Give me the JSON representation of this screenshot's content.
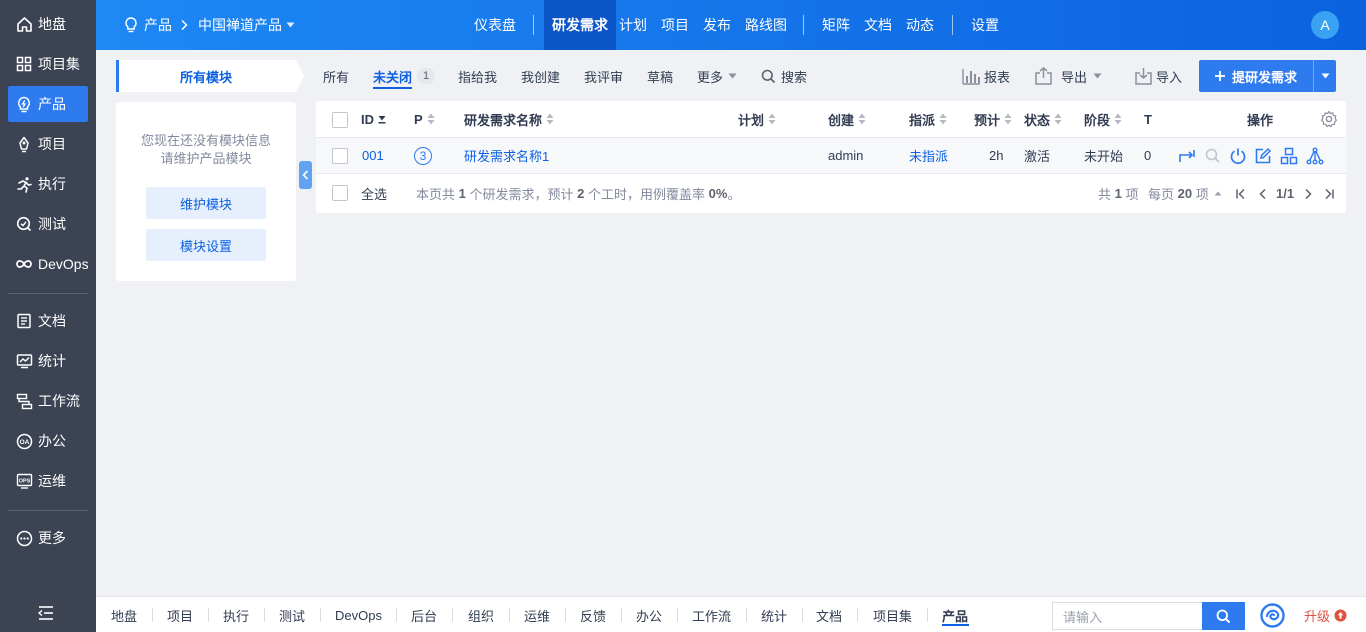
{
  "sidebar": {
    "items": [
      {
        "label": "地盘",
        "icon": "home-icon"
      },
      {
        "label": "项目集",
        "icon": "grid-icon"
      },
      {
        "label": "产品",
        "icon": "lightbulb-icon"
      },
      {
        "label": "项目",
        "icon": "project-icon"
      },
      {
        "label": "执行",
        "icon": "run-icon"
      },
      {
        "label": "测试",
        "icon": "test-icon"
      },
      {
        "label": "DevOps",
        "icon": "infinity-icon"
      },
      {
        "label": "文档",
        "icon": "doc-icon"
      },
      {
        "label": "统计",
        "icon": "chart-icon"
      },
      {
        "label": "工作流",
        "icon": "workflow-icon"
      },
      {
        "label": "办公",
        "icon": "oa-icon"
      },
      {
        "label": "运维",
        "icon": "ops-icon"
      },
      {
        "label": "更多",
        "icon": "more-icon"
      }
    ],
    "active_index": 2
  },
  "header": {
    "crumb_product": "产品",
    "crumb_name": "中国禅道产品",
    "nav": [
      "仪表盘",
      "研发需求",
      "计划",
      "项目",
      "发布",
      "路线图",
      "矩阵",
      "文档",
      "动态",
      "设置"
    ],
    "active_nav": "研发需求",
    "avatar": "A"
  },
  "module": {
    "title": "所有模块",
    "empty_line1": "您现在还没有模块信息",
    "empty_line2": "请维护产品模块",
    "maintain_btn": "维护模块",
    "settings_btn": "模块设置"
  },
  "filters": {
    "tabs": [
      "所有",
      "未关闭",
      "指给我",
      "我创建",
      "我评审",
      "草稿",
      "更多"
    ],
    "active_tab": "未关闭",
    "unclosed_count": "1",
    "search": "搜索",
    "report": "报表",
    "export": "导出",
    "import": "导入",
    "create": "提研发需求"
  },
  "table": {
    "columns": {
      "id": "ID",
      "pri": "P",
      "name": "研发需求名称",
      "plan": "计划",
      "creator": "创建",
      "assigned": "指派",
      "estimate": "预计",
      "status": "状态",
      "stage": "阶段",
      "tasks": "T",
      "actions": "操作"
    },
    "rows": [
      {
        "id": "001",
        "pri": "3",
        "name": "研发需求名称1",
        "plan": "",
        "creator": "admin",
        "assigned": "未指派",
        "estimate": "2h",
        "status": "激活",
        "stage": "未开始",
        "tasks": "0"
      }
    ],
    "select_all": "全选",
    "summary_prefix": "本页共",
    "summary_count": "1",
    "summary_mid": "个研发需求，预计",
    "summary_hours": "2",
    "summary_mid2": "个工时，用例覆盖率",
    "summary_rate": "0%",
    "summary_end": "。",
    "total_prefix": "共",
    "total_count": "1",
    "total_suffix": "项",
    "per_page_prefix": "每页",
    "per_page": "20",
    "per_page_suffix": "项",
    "page_info": "1/1"
  },
  "bottombar": {
    "items": [
      "地盘",
      "项目",
      "执行",
      "测试",
      "DevOps",
      "后台",
      "组织",
      "运维",
      "反馈",
      "办公",
      "工作流",
      "统计",
      "文档",
      "项目集",
      "产品"
    ],
    "active": "产品",
    "search_placeholder": "请输入",
    "upgrade": "升级"
  },
  "colors": {
    "accent": "#2e7bf0",
    "sidebar": "#3c4353",
    "danger": "#e0513d"
  }
}
